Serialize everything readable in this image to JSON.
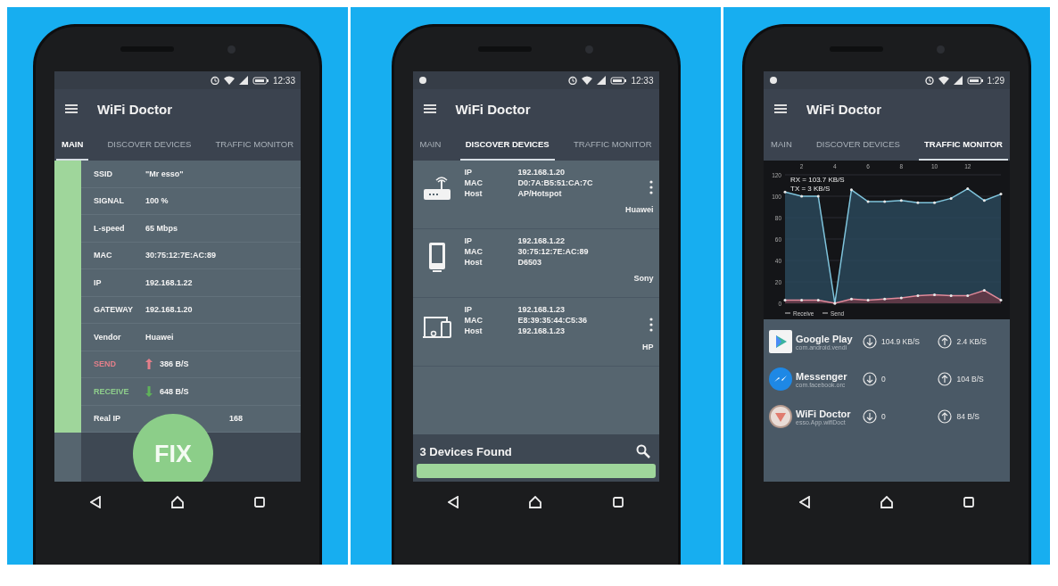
{
  "screens": [
    {
      "kind": "main",
      "status_bar": {
        "time": "12:33"
      },
      "app_bar": {
        "title": "WiFi Doctor"
      },
      "tabs": [
        {
          "label": "MAIN",
          "selected": true
        },
        {
          "label": "DISCOVER DEVICES",
          "selected": false
        },
        {
          "label": "TRAFFIC MONITOR",
          "selected": false
        }
      ],
      "signal_bar": {
        "level": 1
      },
      "rows": [
        {
          "kind": "info",
          "label": "SSID",
          "value": "\"Mr esso\""
        },
        {
          "kind": "info",
          "label": "SIGNAL",
          "value": "100 %"
        },
        {
          "kind": "info",
          "label": "L-speed",
          "value": "65 Mbps"
        },
        {
          "kind": "info",
          "label": "MAC",
          "value": "30:75:12:7E:AC:89"
        },
        {
          "kind": "info",
          "label": "IP",
          "value": "192.168.1.22"
        },
        {
          "kind": "info",
          "label": "GATEWAY",
          "value": "192.168.1.20"
        },
        {
          "kind": "info",
          "label": "Vendor",
          "value": "Huawei"
        },
        {
          "kind": "send",
          "label": "SEND",
          "value": "386 B/S"
        },
        {
          "kind": "receive",
          "label": "RECEIVE",
          "value": "648 B/S"
        },
        {
          "kind": "covered",
          "label": "Real IP",
          "value": "168"
        }
      ],
      "fix_button": "FIX"
    },
    {
      "kind": "devices",
      "status_bar": {
        "time": "12:33"
      },
      "app_bar": {
        "title": "WiFi Doctor"
      },
      "tabs": [
        {
          "label": "MAIN",
          "selected": false
        },
        {
          "label": "DISCOVER DEVICES",
          "selected": true
        },
        {
          "label": "TRAFFIC MONITOR",
          "selected": false
        }
      ],
      "devices": [
        {
          "kind": "router",
          "ip_label": "IP",
          "ip": "192.168.1.20",
          "mac_label": "MAC",
          "mac": "D0:7A:B5:51:CA:7C",
          "host_label": "Host",
          "host": "AP/Hotspot",
          "vendor": "Huawei",
          "menu": true
        },
        {
          "kind": "phone",
          "ip_label": "IP",
          "ip": "192.168.1.22",
          "mac_label": "MAC",
          "mac": "30:75:12:7E:AC:89",
          "host_label": "Host",
          "host": "D6503",
          "vendor": "Sony",
          "menu": false
        },
        {
          "kind": "computer",
          "ip_label": "IP",
          "ip": "192.168.1.23",
          "mac_label": "MAC",
          "mac": "E8:39:35:44:C5:36",
          "host_label": "Host",
          "host": "192.168.1.23",
          "vendor": "HP",
          "menu": true
        }
      ],
      "footer": {
        "text": "3 Devices Found"
      },
      "progress": {
        "level": 1
      }
    },
    {
      "kind": "traffic",
      "status_bar": {
        "time": "1:29"
      },
      "app_bar": {
        "title": "WiFi Doctor"
      },
      "tabs": [
        {
          "label": "MAIN",
          "selected": false
        },
        {
          "label": "DISCOVER DEVICES",
          "selected": false
        },
        {
          "label": "TRAFFIC MONITOR",
          "selected": true
        }
      ],
      "chart_data": {
        "type": "area",
        "x": [
          1,
          2,
          3,
          4,
          5,
          6,
          7,
          8,
          9,
          10,
          11,
          12,
          13,
          14
        ],
        "series": [
          {
            "name": "Receive",
            "color": "#7fc4dc",
            "values": [
              104,
              100,
              100,
              0,
              106,
              95,
              95,
              96,
              94,
              94,
              98,
              107,
              96,
              102
            ]
          },
          {
            "name": "Send",
            "color": "#e08a9a",
            "values": [
              3,
              3,
              3,
              0,
              4,
              3,
              4,
              5,
              7,
              8,
              7,
              7,
              12,
              3
            ]
          }
        ],
        "grid": true,
        "xlim": [
          1,
          14
        ],
        "ylim": [
          0,
          120
        ],
        "xticks": [
          2,
          4,
          6,
          8,
          10,
          12
        ],
        "yticks": [
          0,
          20,
          40,
          60,
          80,
          100,
          120
        ],
        "annotations": [
          "RX = 103.7 KB/S",
          "TX = 3 KB/S"
        ]
      },
      "apps": [
        {
          "kind": "play",
          "name": "Google Play",
          "package": "com.android.vendi",
          "download": "104.9 KB/S",
          "upload": "2.4 KB/S"
        },
        {
          "kind": "messenger",
          "name": "Messenger",
          "package": "com.facebook.orc",
          "download": "0",
          "upload": "104 B/S"
        },
        {
          "kind": "doctor",
          "name": "WiFi Doctor",
          "package": "esso.App.wifiDoct",
          "download": "0",
          "upload": "84 B/S"
        }
      ]
    }
  ]
}
